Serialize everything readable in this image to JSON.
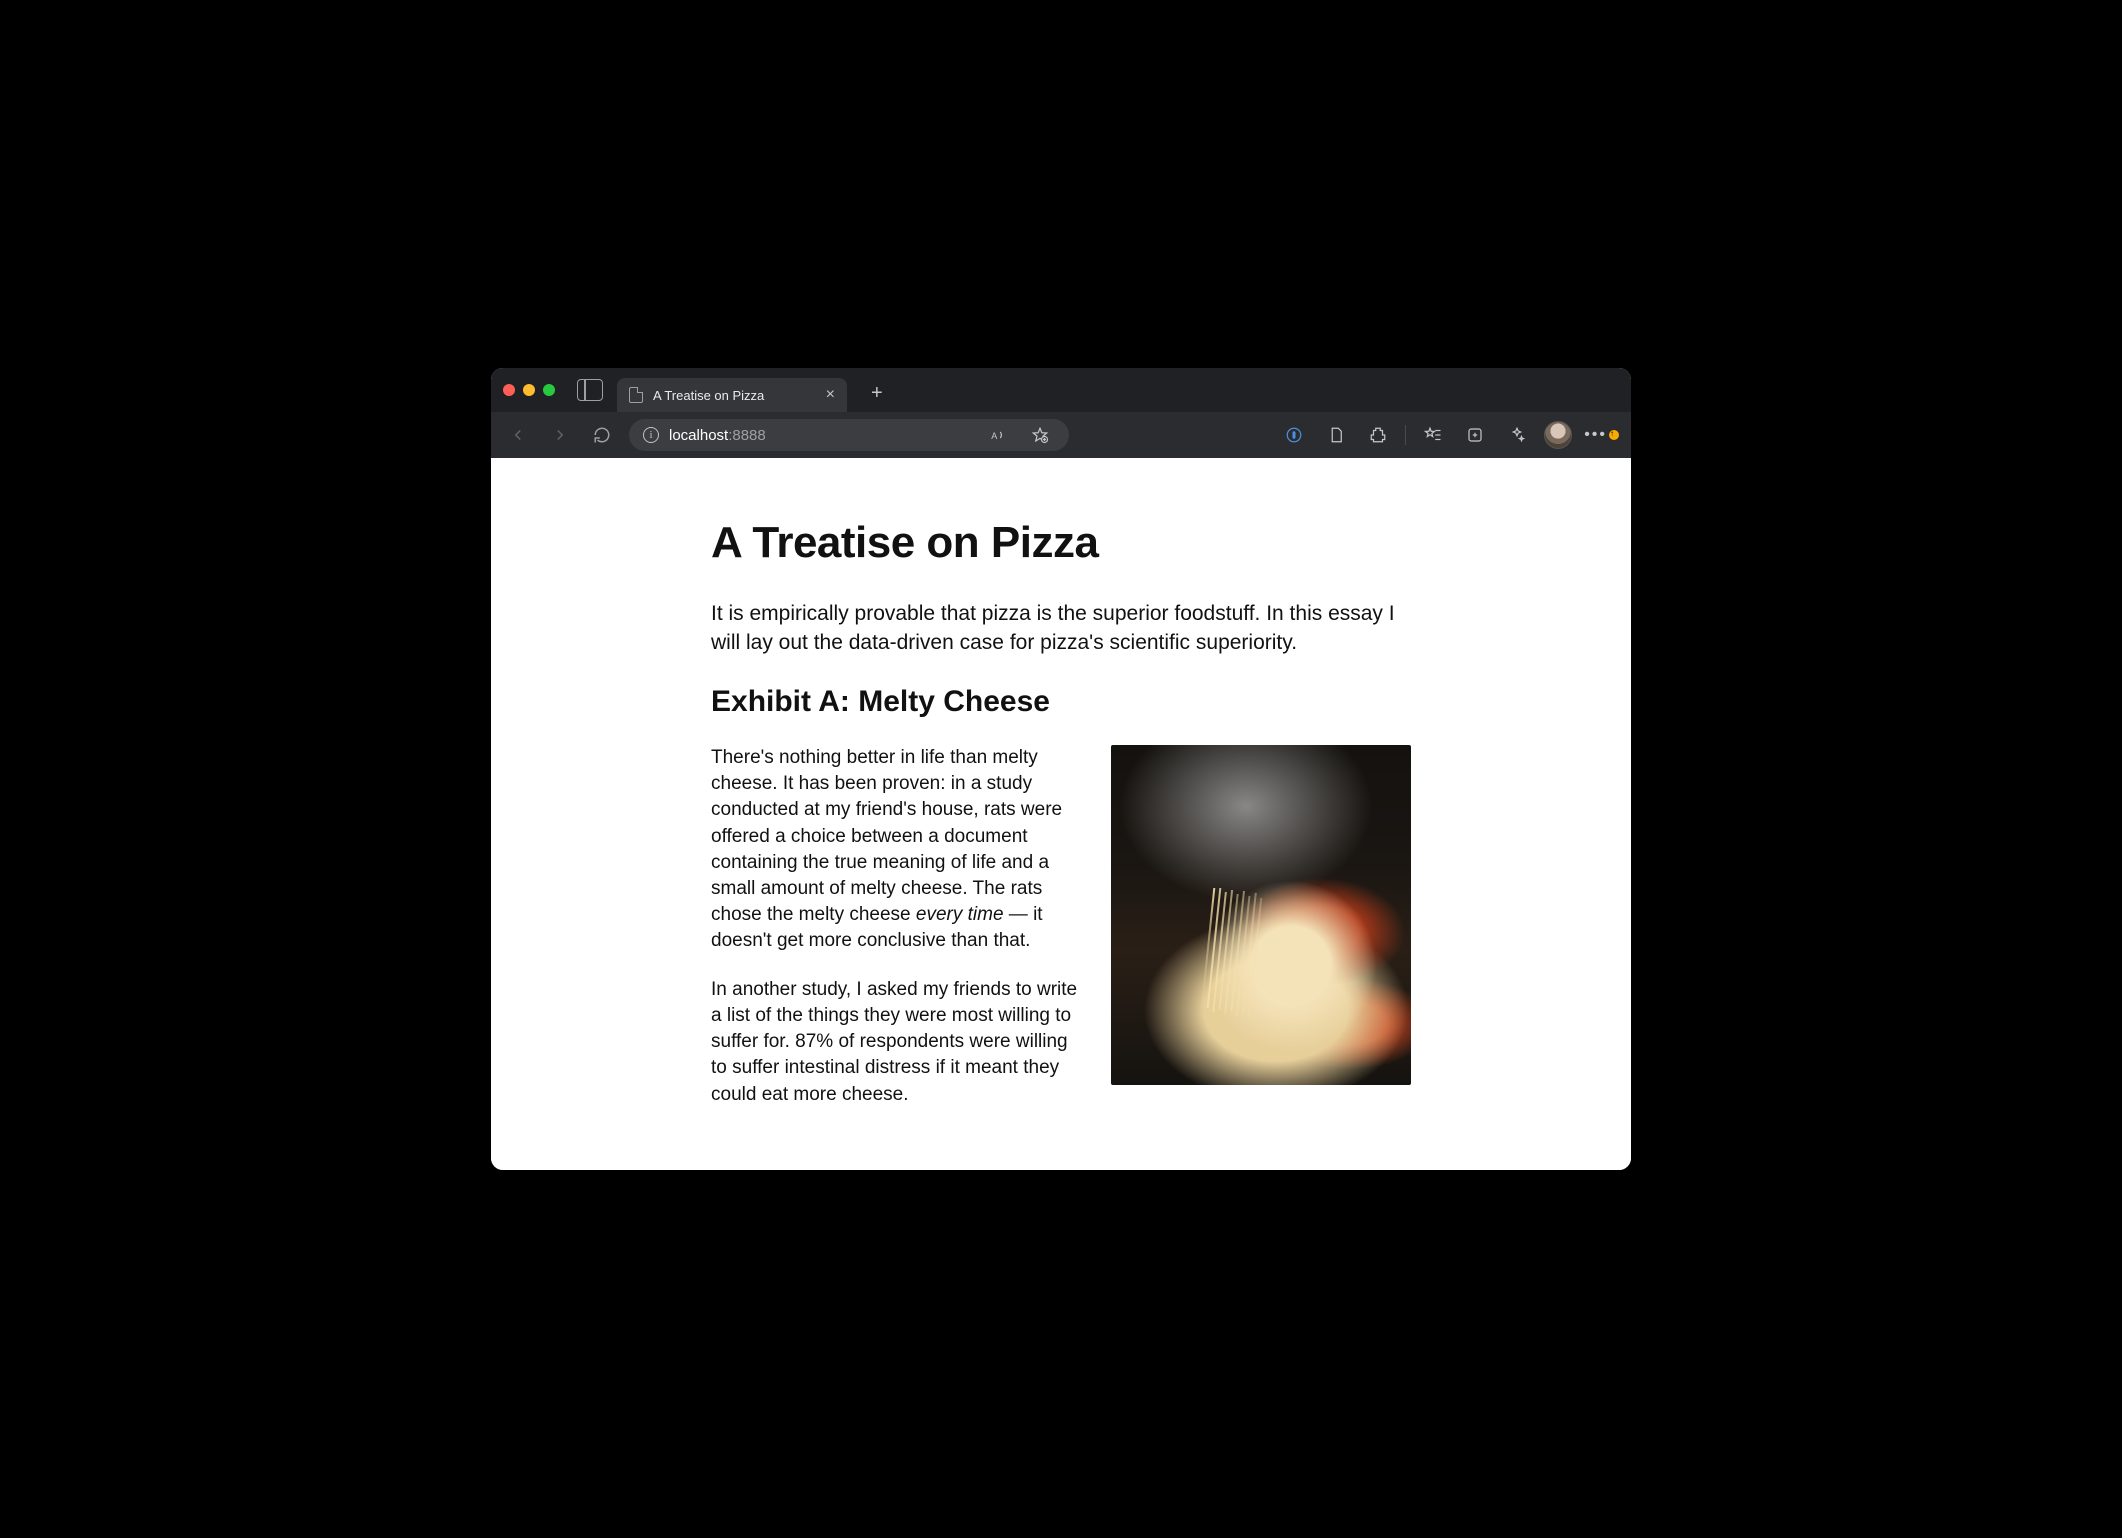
{
  "tab": {
    "title": "A Treatise on Pizza"
  },
  "address": {
    "host": "localhost",
    "port": ":8888"
  },
  "page": {
    "h1": "A Treatise on Pizza",
    "intro": "It is empirically provable that pizza is the superior foodstuff. In this essay I will lay out the data-driven case for pizza's scientific superiority.",
    "h2": "Exhibit A: Melty Cheese",
    "p1_a": "There's nothing better in life than melty cheese. It has been proven: in a study conducted at my friend's house, rats were offered a choice between a document containing the true meaning of life and a small amount of melty cheese. The rats chose the melty cheese ",
    "p1_em": "every time",
    "p1_b": " — it doesn't get more conclusive than that.",
    "p2": "In another study, I asked my friends to write a list of the things they were most willing to suffer for. 87% of respondents were willing to suffer intestinal distress if it meant they could eat more cheese."
  }
}
